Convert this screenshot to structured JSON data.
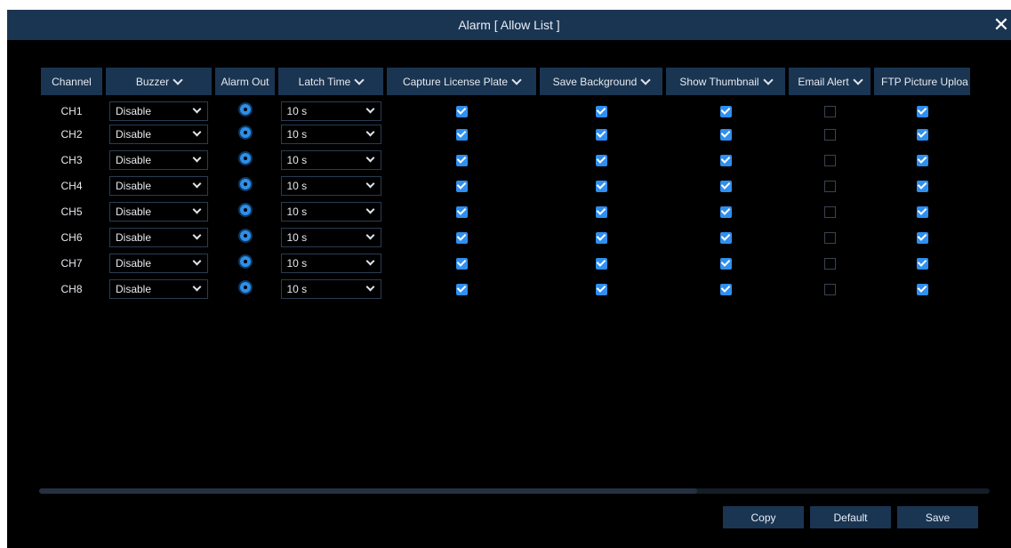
{
  "dialog": {
    "title": "Alarm [ Allow List ]",
    "close_glyph": "✕"
  },
  "columns": {
    "channel": "Channel",
    "buzzer": "Buzzer",
    "alarm_out": "Alarm Out",
    "latch_time": "Latch Time",
    "capture_plate": "Capture License Plate",
    "save_background": "Save Background",
    "show_thumbnail": "Show Thumbnail",
    "email_alert": "Email Alert",
    "ftp_upload": "FTP Picture Uploa"
  },
  "rows": [
    {
      "channel": "CH1",
      "buzzer": "Disable",
      "latch": "10 s",
      "capture": true,
      "save_bg": true,
      "thumb": true,
      "email": false,
      "ftp": true
    },
    {
      "channel": "CH2",
      "buzzer": "Disable",
      "latch": "10 s",
      "capture": true,
      "save_bg": true,
      "thumb": true,
      "email": false,
      "ftp": true
    },
    {
      "channel": "CH3",
      "buzzer": "Disable",
      "latch": "10 s",
      "capture": true,
      "save_bg": true,
      "thumb": true,
      "email": false,
      "ftp": true
    },
    {
      "channel": "CH4",
      "buzzer": "Disable",
      "latch": "10 s",
      "capture": true,
      "save_bg": true,
      "thumb": true,
      "email": false,
      "ftp": true
    },
    {
      "channel": "CH5",
      "buzzer": "Disable",
      "latch": "10 s",
      "capture": true,
      "save_bg": true,
      "thumb": true,
      "email": false,
      "ftp": true
    },
    {
      "channel": "CH6",
      "buzzer": "Disable",
      "latch": "10 s",
      "capture": true,
      "save_bg": true,
      "thumb": true,
      "email": false,
      "ftp": true
    },
    {
      "channel": "CH7",
      "buzzer": "Disable",
      "latch": "10 s",
      "capture": true,
      "save_bg": true,
      "thumb": true,
      "email": false,
      "ftp": true
    },
    {
      "channel": "CH8",
      "buzzer": "Disable",
      "latch": "10 s",
      "capture": true,
      "save_bg": true,
      "thumb": true,
      "email": false,
      "ftp": true
    }
  ],
  "buttons": {
    "copy": "Copy",
    "default": "Default",
    "save": "Save"
  },
  "icons": {
    "alarm_out": "gear-icon",
    "dropdown": "chevron-down-icon",
    "close": "close-icon"
  },
  "colors": {
    "header_bg": "#1a3552",
    "checkbox_on": "#2f8ff0",
    "gear": "#2e8fe8"
  }
}
